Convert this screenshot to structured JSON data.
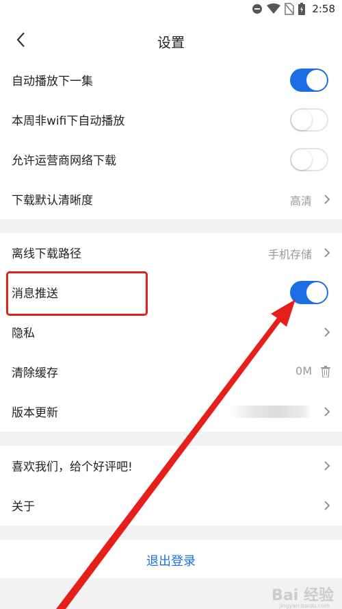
{
  "status_bar": {
    "time": "2:58",
    "icons": [
      "dnd-icon",
      "wifi-icon",
      "no-sim-icon",
      "battery-icon"
    ]
  },
  "header": {
    "title": "设置",
    "back_icon": "chevron-left-icon"
  },
  "group1": [
    {
      "label": "自动播放下一集",
      "control": "toggle",
      "state": "on"
    },
    {
      "label": "本周非wifi下自动播放",
      "control": "toggle",
      "state": "off"
    },
    {
      "label": "允许运营商网络下载",
      "control": "toggle",
      "state": "off"
    },
    {
      "label": "下载默认清晰度",
      "control": "value",
      "value": "高清"
    }
  ],
  "group2": [
    {
      "label": "离线下载路径",
      "control": "value",
      "value": "手机存储"
    },
    {
      "label": "消息推送",
      "control": "toggle",
      "state": "on"
    },
    {
      "label": "隐私",
      "control": "chevron"
    },
    {
      "label": "清除缓存",
      "control": "value",
      "value": "0M"
    },
    {
      "label": "版本更新",
      "control": "chevron"
    }
  ],
  "group3": [
    {
      "label": "喜欢我们，给个好评吧!",
      "control": "chevron"
    },
    {
      "label": "关于",
      "control": "chevron"
    }
  ],
  "logout": {
    "label": "退出登录"
  },
  "colors": {
    "accent": "#1b6fe2",
    "annotation": "#e5201c"
  },
  "watermark": {
    "text": "Bai 经验",
    "sub": "jingyan.baidu.com"
  }
}
